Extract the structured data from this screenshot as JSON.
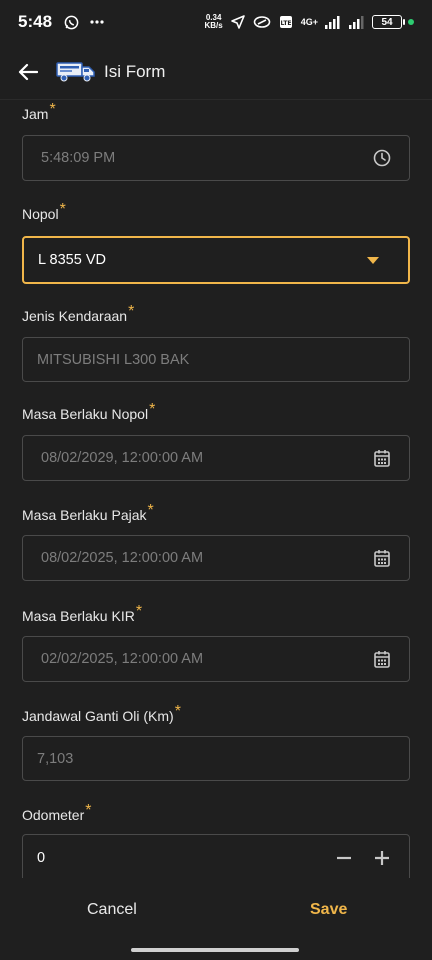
{
  "status_bar": {
    "time": "5:48",
    "net_speed_value": "0.34",
    "net_speed_unit": "KB/s",
    "network_type": "4G+",
    "battery": "54",
    "icons": [
      "whatsapp-icon",
      "more-icon",
      "navigation-icon",
      "link-icon",
      "volte-icon",
      "signal-icon",
      "battery-icon"
    ]
  },
  "app_bar": {
    "title": "Isi Form",
    "logo_icon": "truck-icon"
  },
  "colors": {
    "background": "#1f1f1f",
    "accent": "#f0b64a",
    "border": "#4a4a4a",
    "placeholder": "#7d7d7d"
  },
  "form": {
    "required_mark": "*",
    "jam": {
      "label": "Jam",
      "value": "5:48:09 PM",
      "icon": "clock-icon"
    },
    "nopol": {
      "label": "Nopol",
      "value": "L 8355 VD",
      "icon": "dropdown-arrow-icon"
    },
    "jenis": {
      "label": "Jenis Kendaraan",
      "value": "MITSUBISHI L300 BAK"
    },
    "masa_nopol": {
      "label": "Masa Berlaku Nopol",
      "value": "08/02/2029, 12:00:00 AM",
      "icon": "calendar-icon"
    },
    "masa_pajak": {
      "label": "Masa Berlaku Pajak",
      "value": "08/02/2025, 12:00:00 AM",
      "icon": "calendar-icon"
    },
    "masa_kir": {
      "label": "Masa Berlaku KIR",
      "value": "02/02/2025, 12:00:00 AM",
      "icon": "calendar-icon"
    },
    "oli": {
      "label": "Jandawal Ganti Oli (Km)",
      "value": "7,103"
    },
    "odometer": {
      "label": "Odometer",
      "value": "0"
    }
  },
  "actions": {
    "cancel": "Cancel",
    "save": "Save"
  }
}
